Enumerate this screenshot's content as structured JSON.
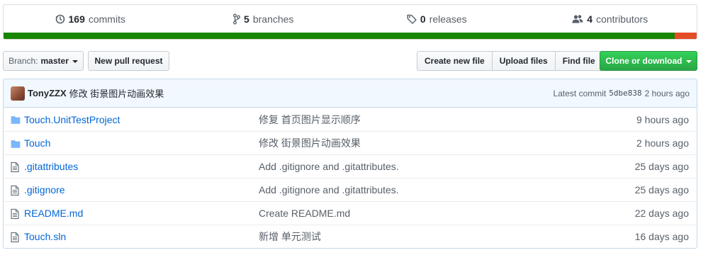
{
  "summary": {
    "commits": {
      "count": "169",
      "label": "commits"
    },
    "branches": {
      "count": "5",
      "label": "branches"
    },
    "releases": {
      "count": "0",
      "label": "releases"
    },
    "contributors": {
      "count": "4",
      "label": "contributors"
    }
  },
  "language_bar": {
    "segments": [
      {
        "color": "#178600",
        "percent": 96.8
      },
      {
        "color": "#e34c26",
        "percent": 3.2
      }
    ]
  },
  "toolbar": {
    "branch_prefix": "Branch:",
    "branch_name": "master",
    "new_pull_request": "New pull request",
    "create_new_file": "Create new file",
    "upload_files": "Upload files",
    "find_file": "Find file",
    "clone_or_download": "Clone or download"
  },
  "latest_commit": {
    "author": "TonyZZX",
    "message": "修改 街景图片动画效果",
    "label": "Latest commit",
    "sha": "5dbe838",
    "age": "2 hours ago"
  },
  "files": [
    {
      "type": "folder",
      "name": "Touch.UnitTestProject",
      "message": "修复 首页图片显示顺序",
      "age": "9 hours ago"
    },
    {
      "type": "folder",
      "name": "Touch",
      "message": "修改 街景图片动画效果",
      "age": "2 hours ago"
    },
    {
      "type": "file",
      "name": ".gitattributes",
      "message": "Add .gitignore and .gitattributes.",
      "age": "25 days ago"
    },
    {
      "type": "file",
      "name": ".gitignore",
      "message": "Add .gitignore and .gitattributes.",
      "age": "25 days ago"
    },
    {
      "type": "file",
      "name": "README.md",
      "message": "Create README.md",
      "age": "22 days ago"
    },
    {
      "type": "file",
      "name": "Touch.sln",
      "message": "新增 单元测试",
      "age": "16 days ago"
    }
  ]
}
